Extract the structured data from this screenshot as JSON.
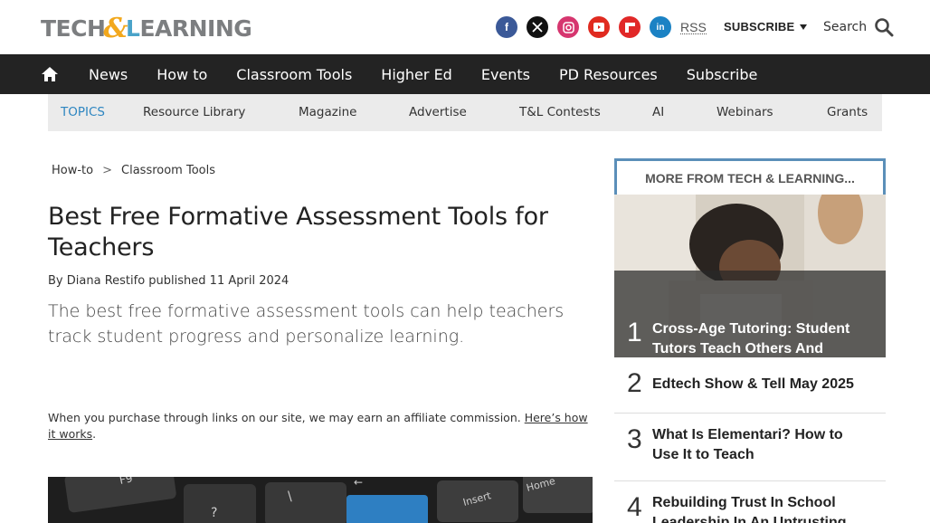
{
  "header": {
    "logo_text_a": "TECH",
    "logo_text_amp": "&",
    "logo_text_l": "L",
    "logo_text_b": "EARNING",
    "social": [
      {
        "name": "facebook-icon",
        "glyph": "f",
        "color": "#3b5998"
      },
      {
        "name": "x-icon",
        "glyph": "X",
        "color": "#111111"
      },
      {
        "name": "instagram-icon",
        "glyph": "◎",
        "color": "#d6366f"
      },
      {
        "name": "youtube-icon",
        "glyph": "▶",
        "color": "#e02b20"
      },
      {
        "name": "flipboard-icon",
        "glyph": "f",
        "color": "#e12828"
      },
      {
        "name": "linkedin-icon",
        "glyph": "in",
        "color": "#1b82c4"
      }
    ],
    "rss_label": "RSS",
    "subscribe_label": "SUBSCRIBE",
    "search_label": "Search"
  },
  "nav": {
    "items": [
      "News",
      "How to",
      "Classroom Tools",
      "Higher Ed",
      "Events",
      "PD Resources",
      "Subscribe"
    ]
  },
  "topics": {
    "label": "TOPICS",
    "items": [
      "Resource Library",
      "Magazine",
      "Advertise",
      "T&L Contests",
      "AI",
      "Webinars",
      "Grants"
    ]
  },
  "article": {
    "breadcrumb": [
      "How-to",
      "Classroom Tools"
    ],
    "breadcrumb_sep": ">",
    "title": "Best Free Formative Assessment Tools for Teachers",
    "byline_prefix": "By",
    "author": "Diana Restifo",
    "published_label": "published",
    "date": "11 April 2024",
    "strapline": "The best free formative assessment tools can help teachers track student progress and personalize learning.",
    "affiliate_text": "When you purchase through links on our site, we may earn an affiliate commission.",
    "affiliate_link": "Here’s how it works",
    "affiliate_end": "."
  },
  "sidebar": {
    "heading": "MORE FROM TECH & LEARNING...",
    "items": [
      {
        "rank": "1",
        "title": "Cross-Age Tutoring: Student Tutors Teach Others And Themselves"
      },
      {
        "rank": "2",
        "title": "Edtech Show & Tell May 2025"
      },
      {
        "rank": "3",
        "title": "What Is Elementari? How to Use It to Teach"
      },
      {
        "rank": "4",
        "title": "Rebuilding Trust In School Leadership In An Untrusting"
      }
    ]
  },
  "colors": {
    "nav_bg": "#232323",
    "topics_bg": "#ebebeb",
    "topics_label": "#2e86c1",
    "sidebar_border": "#5b8fb9",
    "logo_amp": "#f2a81d",
    "logo_l": "#4aa3c9"
  }
}
